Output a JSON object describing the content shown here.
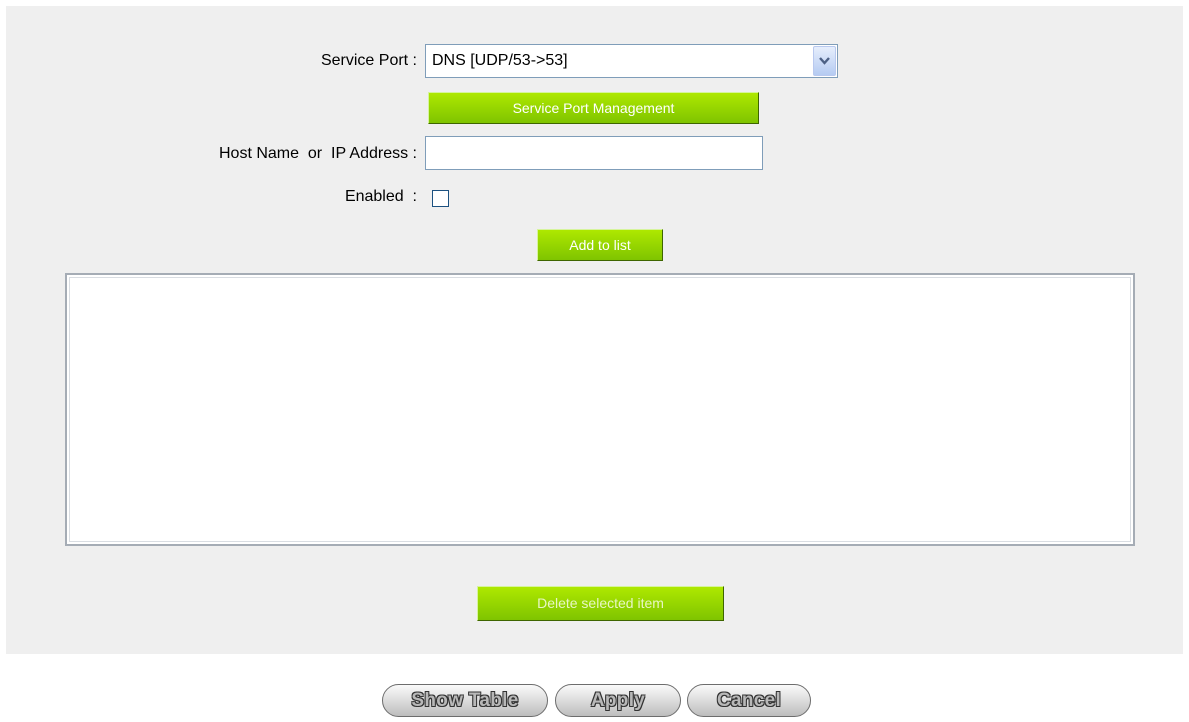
{
  "form": {
    "service_port_label": "Service Port :",
    "service_port_value": "DNS [UDP/53->53]",
    "service_port_management_label": "Service Port Management",
    "host_label": "Host Name  or  IP Address :",
    "host_value": "",
    "enabled_label": "Enabled  :",
    "enabled_checked": false,
    "add_to_list_label": "Add to list"
  },
  "list": {
    "items": []
  },
  "delete_selected_label": "Delete selected item",
  "footer": {
    "show_table_label": "Show Table",
    "apply_label": "Apply",
    "cancel_label": "Cancel"
  },
  "colors": {
    "panel_bg": "#efefef",
    "green_button": "#9bd800",
    "select_border": "#7f9db9"
  },
  "icons": {
    "dropdown": "chevron-down-icon"
  }
}
